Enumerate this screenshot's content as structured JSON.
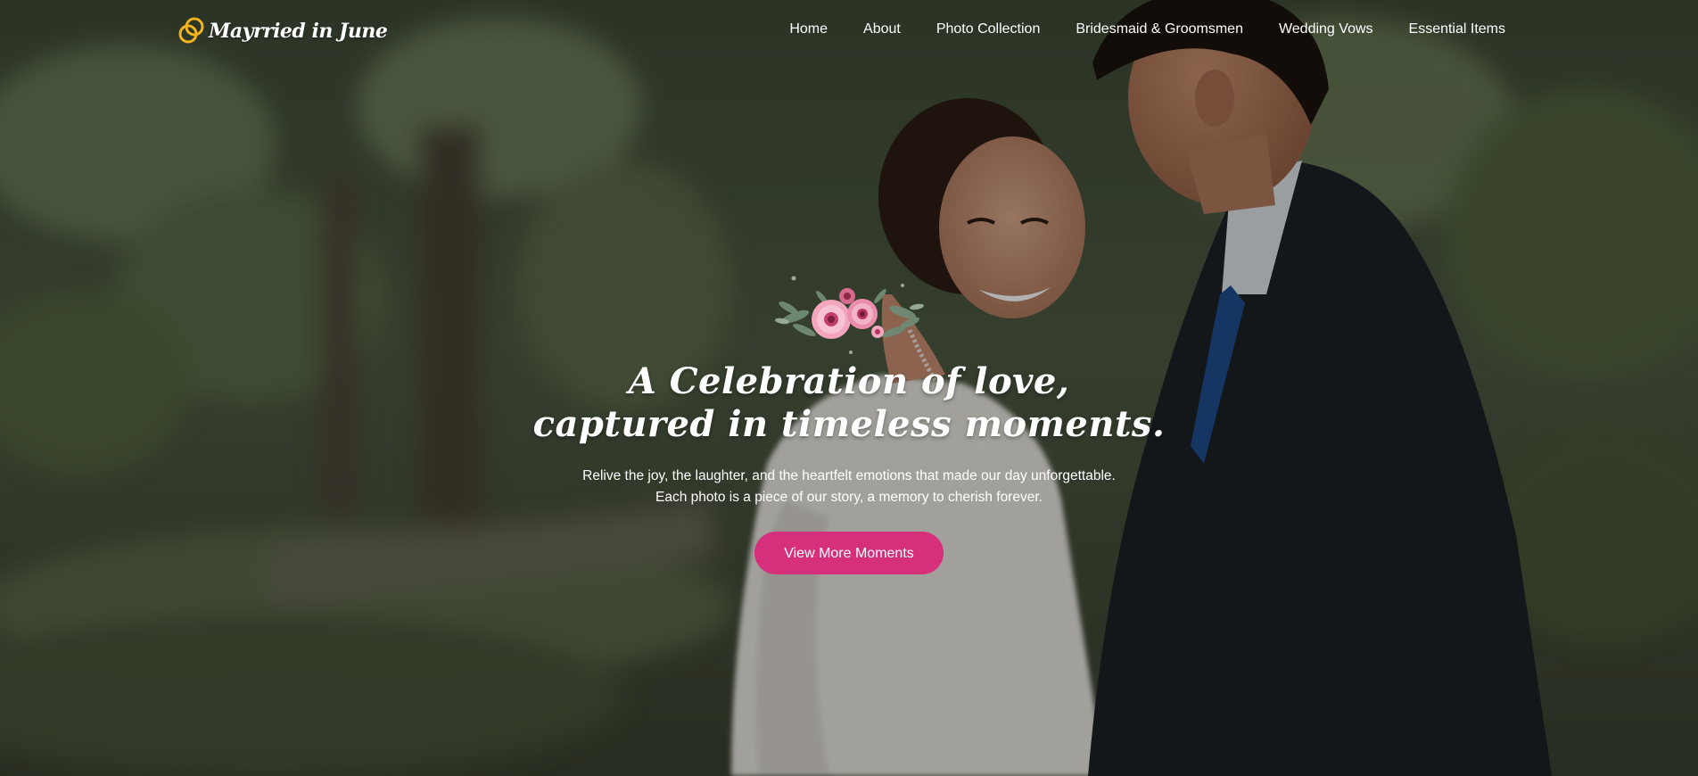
{
  "brand": {
    "name": "Mayrried in June",
    "ring_color": "#f2b321"
  },
  "nav": {
    "items": [
      {
        "label": "Home"
      },
      {
        "label": "About"
      },
      {
        "label": "Photo Collection"
      },
      {
        "label": "Bridesmaid & Groomsmen"
      },
      {
        "label": "Wedding Vows"
      },
      {
        "label": "Essential Items"
      }
    ]
  },
  "hero": {
    "headline_line1": "A Celebration of love,",
    "headline_line2": "captured in timeless moments.",
    "subtext_line1": "Relive the joy, the laughter, and the heartfelt emotions that made our day unforgettable.",
    "subtext_line2": "Each photo is a piece of our story, a memory to cherish forever.",
    "cta_label": "View More Moments",
    "cta_color": "#d62f7c",
    "decoration_icon": "pink-flowers-icon",
    "background_photo": "couple-forehead-kiss-garden-photo"
  }
}
